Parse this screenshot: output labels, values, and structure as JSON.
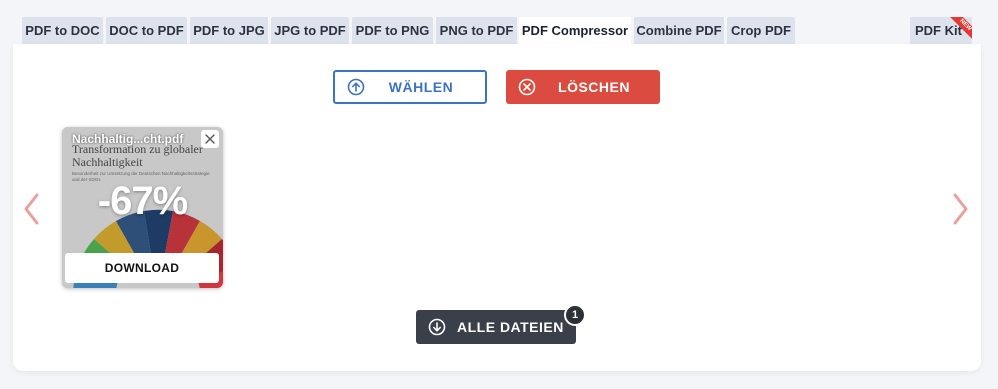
{
  "tabs": [
    {
      "label": "PDF to DOC"
    },
    {
      "label": "DOC to PDF"
    },
    {
      "label": "PDF to JPG"
    },
    {
      "label": "JPG to PDF"
    },
    {
      "label": "PDF to PNG"
    },
    {
      "label": "PNG to PDF"
    },
    {
      "label": "PDF Compressor",
      "active": true
    },
    {
      "label": "Combine PDF"
    },
    {
      "label": "Crop PDF"
    },
    {
      "label": "PDF Kit",
      "badge": "NEW"
    }
  ],
  "actions": {
    "choose_label": "WÄHLEN",
    "clear_label": "LÖSCHEN",
    "choose_icon": "upload-arrow-icon",
    "clear_icon": "circle-x-icon"
  },
  "file_card": {
    "filename": "Nachhaltig...cht.pdf",
    "thumbnail_title": "Transformation zu globaler Nachhaltigkeit",
    "thumbnail_subtitle": "Besonderheit zur Umsetzung der Deutschen Nachhaltigkeitsstrategie und der SDGs",
    "reduction": "-67%",
    "download_label": "DOWNLOAD"
  },
  "download_all": {
    "label": "ALLE DATEIEN",
    "count": "1",
    "icon": "download-arrow-icon"
  },
  "colors": {
    "accent_blue": "#3c73c4",
    "danger_red": "#dc4b3f",
    "dark_button": "#3b3f4a",
    "nav_arrow": "#e8a19a",
    "tab_bg": "#dde2ec"
  }
}
